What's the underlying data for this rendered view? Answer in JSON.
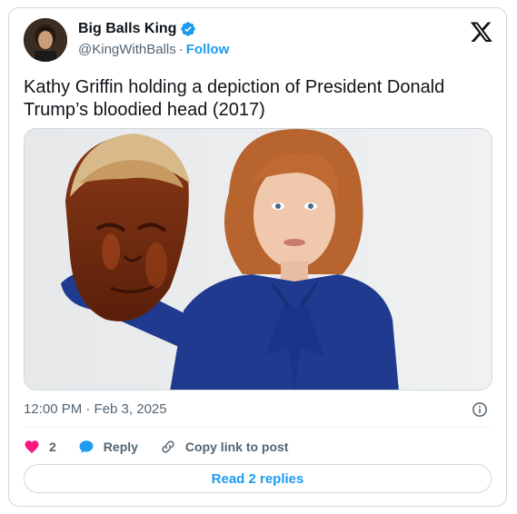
{
  "author": {
    "display_name": "Big Balls King",
    "handle": "@KingWithBalls",
    "separator": "·",
    "follow_label": "Follow",
    "verified": true
  },
  "tweet": {
    "text": "Kathy Griffin holding a depiction of President Donald Trump’s bloodied head (2017)",
    "timestamp": "12:00 PM · Feb 3, 2025",
    "media_icon": "photo"
  },
  "actions": {
    "like_count": "2",
    "reply_label": "Reply",
    "copy_link_label": "Copy link to post"
  },
  "read_replies_label": "Read 2 replies",
  "icons": {
    "verified": "verified-badge-icon",
    "logo": "x-logo-icon",
    "info": "info-icon",
    "like": "heart-icon",
    "reply": "reply-bubble-icon",
    "link": "link-icon"
  },
  "colors": {
    "accent": "#1d9bf0",
    "like": "#f91880",
    "text": "#0f1419",
    "muted": "#536471",
    "border": "#cfd9de"
  }
}
